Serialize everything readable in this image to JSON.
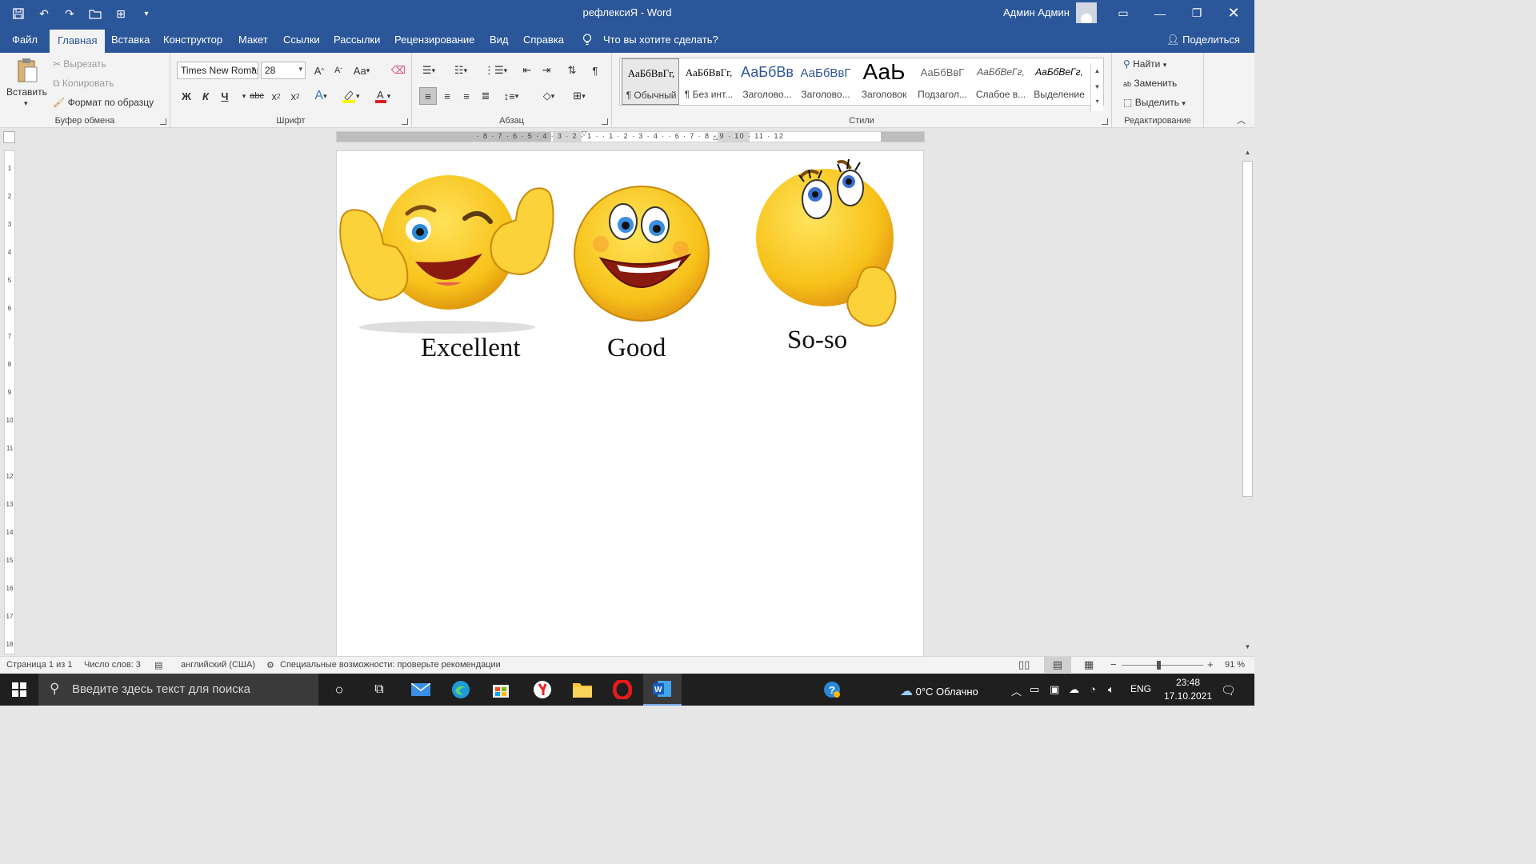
{
  "window": {
    "title": "рефлексиЯ - Word",
    "user": "Админ Админ"
  },
  "tabs": [
    {
      "id": "file",
      "label": "Файл"
    },
    {
      "id": "home",
      "label": "Главная"
    },
    {
      "id": "insert",
      "label": "Вставка"
    },
    {
      "id": "design",
      "label": "Конструктор"
    },
    {
      "id": "layout",
      "label": "Макет"
    },
    {
      "id": "refs",
      "label": "Ссылки"
    },
    {
      "id": "mail",
      "label": "Рассылки"
    },
    {
      "id": "review",
      "label": "Рецензирование"
    },
    {
      "id": "view",
      "label": "Вид"
    },
    {
      "id": "help",
      "label": "Справка"
    }
  ],
  "tell_me": "Что вы хотите сделать?",
  "share": "Поделиться",
  "clipboard": {
    "paste": "Вставить",
    "cut": "Вырезать",
    "copy": "Копировать",
    "format_painter": "Формат по образцу",
    "label": "Буфер обмена"
  },
  "font": {
    "name": "Times New Roman",
    "size": "28",
    "label": "Шрифт",
    "bold": "Ж",
    "italic": "К",
    "underline": "Ч",
    "strike": "abc",
    "grow": "A",
    "shrink": "A",
    "case": "Aa"
  },
  "paragraph": {
    "label": "Абзац",
    "pilcrow": "¶"
  },
  "styles": {
    "label": "Стили",
    "items": [
      {
        "preview": "АаБбВвГг,",
        "name": "¶ Обычный"
      },
      {
        "preview": "АаБбВвГг,",
        "name": "¶ Без инт..."
      },
      {
        "preview": "АаБбВв",
        "name": "Заголово..."
      },
      {
        "preview": "АаБбВвГ",
        "name": "Заголово..."
      },
      {
        "preview": "АаЬ",
        "name": "Заголовок"
      },
      {
        "preview": "АаБбВвГ",
        "name": "Подзагол..."
      },
      {
        "preview": "АаБбВеГг,",
        "name": "Слабое в..."
      },
      {
        "preview": "АаБбВеГг,",
        "name": "Выделение"
      }
    ]
  },
  "editing": {
    "label": "Редактирование",
    "find": "Найти",
    "replace": "Заменить",
    "select": "Выделить"
  },
  "ruler": {
    "marks": "· 8 · 7 · 6 · 5 · 4 · 3 · 2 · 1 ·   · 1 · 2 · 3 · 4 ·   · 6 · 7 · 8 · 9 · 10 · 11 · 12",
    "vmarks": [
      "1",
      "2",
      "3",
      "4",
      "5",
      "6",
      "7",
      "8",
      "9",
      "10",
      "11",
      "12",
      "13",
      "14",
      "15",
      "16",
      "17",
      "18"
    ]
  },
  "document": {
    "captions": [
      "Excellent",
      "Good",
      "So-so"
    ]
  },
  "status": {
    "page": "Страница 1 из 1",
    "words": "Число слов: 3",
    "language": "английский (США)",
    "accessibility": "Специальные возможности: проверьте рекомендации",
    "zoom": "91 %"
  },
  "taskbar": {
    "search_placeholder": "Введите здесь текст для поиска",
    "weather": "0°C  Облачно",
    "lang": "ENG",
    "time": "23:48",
    "date": "17.10.2021"
  },
  "colors": {
    "word_blue": "#2b579a",
    "emoji_yellow": "#f7c21a",
    "highlight": "#ffff00",
    "font_red": "#e02020"
  }
}
